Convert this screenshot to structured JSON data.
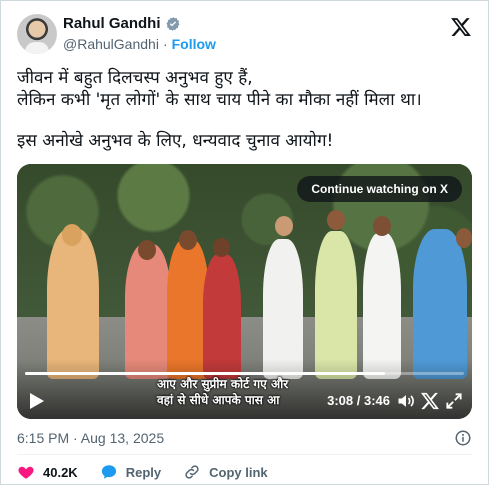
{
  "author": {
    "name": "Rahul Gandhi",
    "handle": "@RahulGandhi",
    "separator": "·",
    "follow_label": "Follow"
  },
  "tweet": {
    "line1": "जीवन में बहुत दिलचस्प अनुभव हुए हैं,",
    "line2": "लेकिन कभी 'मृत लोगों' के साथ चाय पीने का मौका नहीं मिला था।",
    "line3": "इस अनोखे अनुभव के लिए, धन्यवाद चुनाव आयोग!"
  },
  "video": {
    "continue_label": "Continue watching on X",
    "subtitle_line1": "आए और सुप्रीम कोर्ट गए और",
    "subtitle_line2": "वहां से सीधे आपके पास आ",
    "time": "3:08 / 3:46",
    "progress_fraction": 0.82
  },
  "meta": {
    "timestamp": "6:15 PM · Aug 13, 2025"
  },
  "actions": {
    "likes": "40.2K",
    "reply": "Reply",
    "copy_link": "Copy link"
  },
  "colors": {
    "accent": "#1d9bf0",
    "like": "#f91880",
    "muted": "#536471"
  },
  "icons": [
    "verified-badge-icon",
    "x-logo-icon",
    "play-icon",
    "volume-icon",
    "x-watermark-icon",
    "fullscreen-icon",
    "info-icon",
    "heart-icon",
    "reply-icon",
    "link-icon"
  ]
}
